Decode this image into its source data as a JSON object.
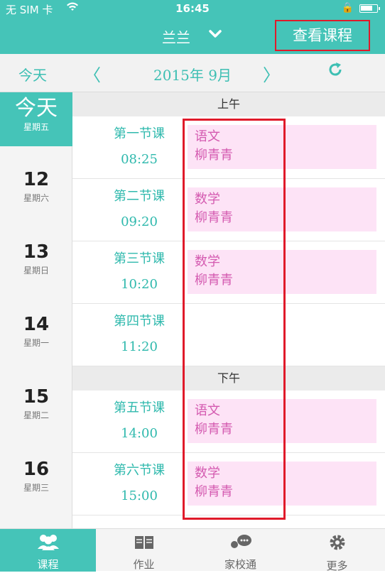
{
  "status": {
    "carrier": "无 SIM 卡",
    "time": "16:45"
  },
  "nav": {
    "name": "兰兰",
    "view_courses": "查看课程"
  },
  "datebar": {
    "today": "今天",
    "month": "2015年 9月"
  },
  "days": [
    {
      "num": "今天",
      "week": "星期五"
    },
    {
      "num": "12",
      "week": "星期六"
    },
    {
      "num": "13",
      "week": "星期日"
    },
    {
      "num": "14",
      "week": "星期一"
    },
    {
      "num": "15",
      "week": "星期二"
    },
    {
      "num": "16",
      "week": "星期三"
    }
  ],
  "sections": {
    "morning": "上午",
    "afternoon": "下午"
  },
  "periods": [
    {
      "name": "第一节课",
      "time": "08:25",
      "subject": "语文",
      "teacher": "柳青青"
    },
    {
      "name": "第二节课",
      "time": "09:20",
      "subject": "数学",
      "teacher": "柳青青"
    },
    {
      "name": "第三节课",
      "time": "10:20",
      "subject": "数学",
      "teacher": "柳青青"
    },
    {
      "name": "第四节课",
      "time": "11:20",
      "subject": "",
      "teacher": ""
    },
    {
      "name": "第五节课",
      "time": "14:00",
      "subject": "语文",
      "teacher": "柳青青"
    },
    {
      "name": "第六节课",
      "time": "15:00",
      "subject": "数学",
      "teacher": "柳青青"
    }
  ],
  "tabs": [
    {
      "label": "课程",
      "icon": "people-icon"
    },
    {
      "label": "作业",
      "icon": "book-icon"
    },
    {
      "label": "家校通",
      "icon": "chat-icon"
    },
    {
      "label": "更多",
      "icon": "gear-icon"
    }
  ],
  "colors": {
    "accent": "#45c4b8",
    "card": "#fde3f6",
    "card_text": "#d45ab0",
    "highlight": "#e01a2a"
  }
}
